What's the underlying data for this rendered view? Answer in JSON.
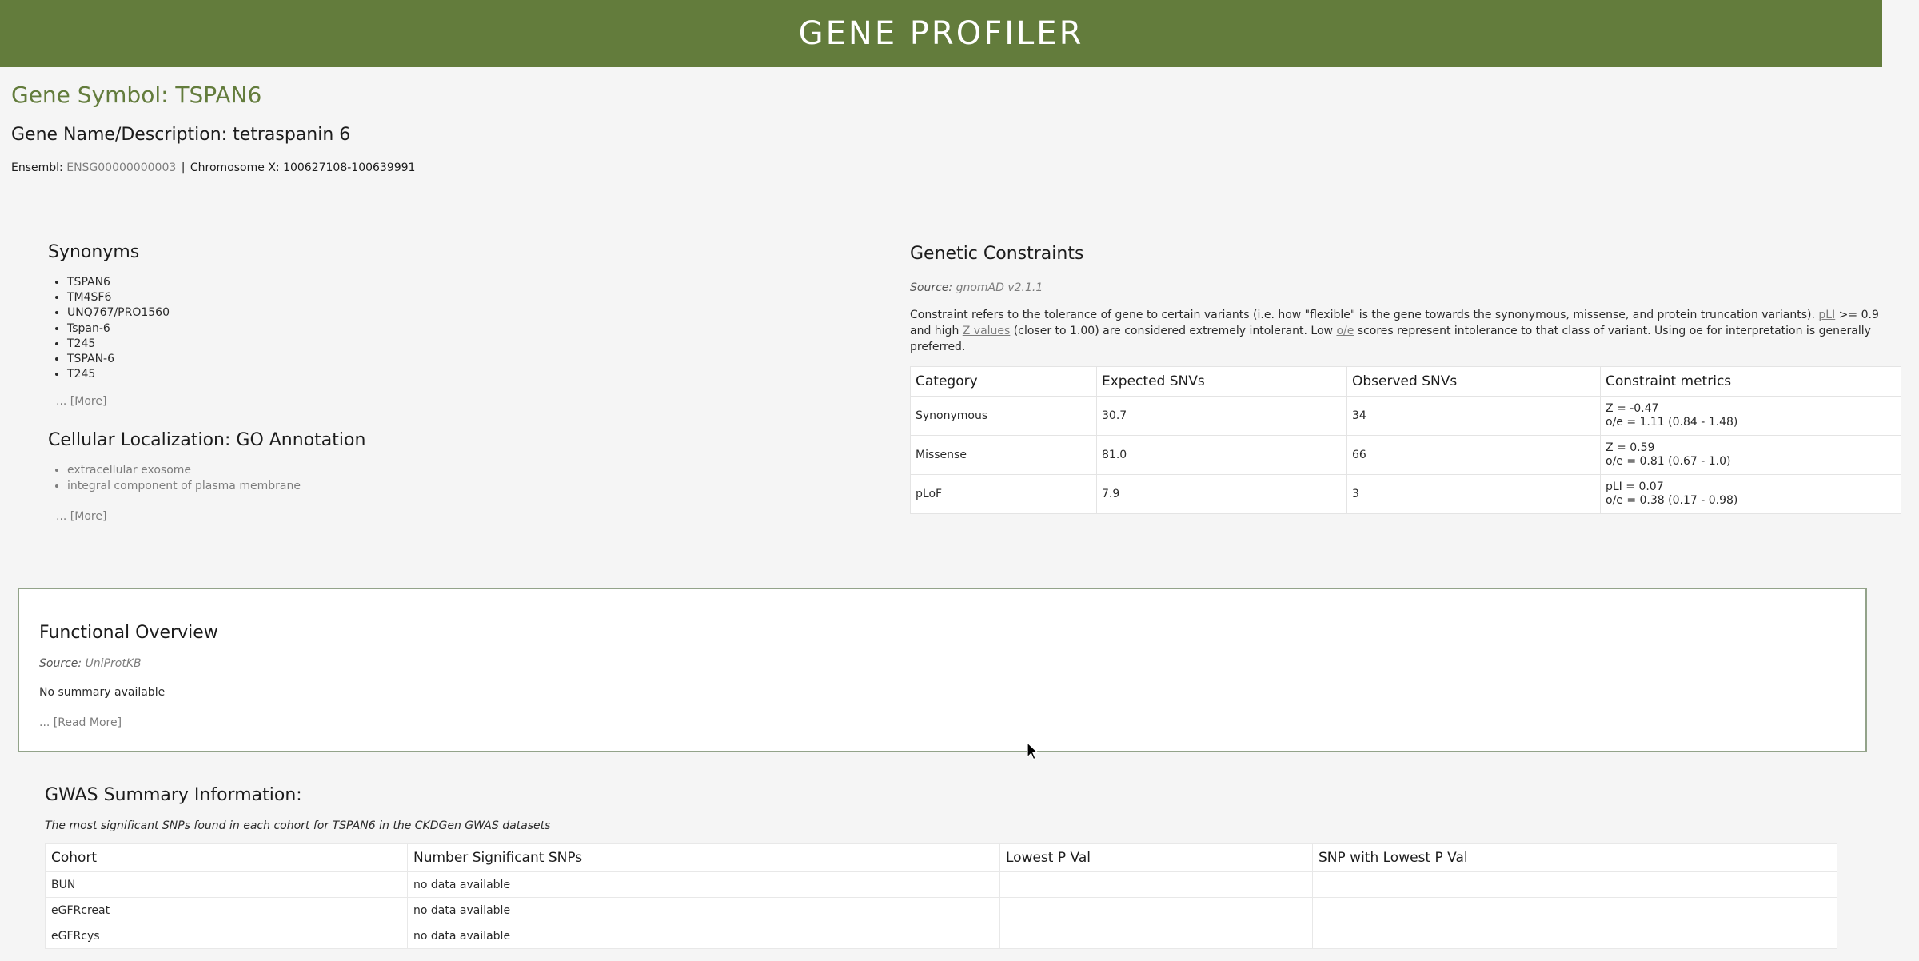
{
  "header": {
    "title": "GENE PROFILER"
  },
  "gene": {
    "symbol_line": "Gene Symbol: TSPAN6",
    "name_line": "Gene Name/Description: tetraspanin 6",
    "ensembl_label": "Ensembl:",
    "ensembl_id": "ENSG00000000003",
    "separator": "|",
    "chromosome": "Chromosome X: 100627108-100639991"
  },
  "synonyms": {
    "title": "Synonyms",
    "items": [
      "TSPAN6",
      "TM4SF6",
      "UNQ767/PRO1560",
      "Tspan-6",
      "T245",
      "TSPAN-6",
      "T245"
    ],
    "more": "... [More]"
  },
  "cellular": {
    "title": "Cellular Localization: GO Annotation",
    "items": [
      "extracellular exosome",
      "integral component of plasma membrane"
    ],
    "more": "... [More]"
  },
  "constraints": {
    "title": "Genetic Constraints",
    "source_label": "Source:",
    "source": "gnomAD v2.1.1",
    "desc_1": "Constraint refers to the tolerance of gene to certain variants (i.e. how \"flexible\" is the gene towards the synonymous, missense, and protein truncation variants). ",
    "pli_link": "pLI",
    "desc_2": " >= 0.9 and high ",
    "z_link": "Z values",
    "desc_3": " (closer to 1.00) are considered extremely intolerant. Low ",
    "oe_link": "o/e",
    "desc_4": " scores represent intolerance to that class of variant. Using oe for interpretation is generally preferred.",
    "headers": [
      "Category",
      "Expected SNVs",
      "Observed SNVs",
      "Constraint metrics"
    ],
    "rows": [
      {
        "category": "Synonymous",
        "expected": "30.7",
        "observed": "34",
        "m1": "Z = -0.47",
        "m2": "o/e = 1.11 (0.84 - 1.48)"
      },
      {
        "category": "Missense",
        "expected": "81.0",
        "observed": "66",
        "m1": "Z = 0.59",
        "m2": "o/e = 0.81 (0.67 - 1.0)"
      },
      {
        "category": "pLoF",
        "expected": "7.9",
        "observed": "3",
        "m1": "pLI = 0.07",
        "m2": "o/e = 0.38 (0.17 - 0.98)"
      }
    ]
  },
  "functional": {
    "title": "Functional Overview",
    "source_label": "Source:",
    "source": "UniProtKB",
    "summary": "No summary available",
    "more": "... [Read More]"
  },
  "gwas": {
    "title": "GWAS Summary Information:",
    "caption": "The most significant SNPs found in each cohort for TSPAN6 in the CKDGen GWAS datasets",
    "headers": [
      "Cohort",
      "Number Significant SNPs",
      "Lowest P Val",
      "SNP with Lowest P Val"
    ],
    "rows": [
      {
        "cohort": "BUN",
        "num": "no data available",
        "pval": "",
        "snp": ""
      },
      {
        "cohort": "eGFRcreat",
        "num": "no data available",
        "pval": "",
        "snp": ""
      },
      {
        "cohort": "eGFRcys",
        "num": "no data available",
        "pval": "",
        "snp": ""
      }
    ]
  },
  "colors": {
    "brand_green": "#637c3c",
    "muted_link": "#7d7d7d"
  }
}
